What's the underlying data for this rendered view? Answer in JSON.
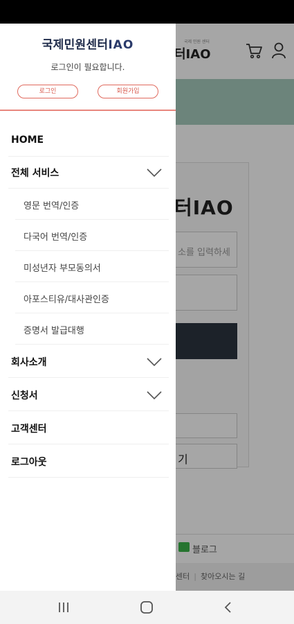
{
  "background": {
    "logo": "터IAO",
    "logo_sub": "국제 민원 센터",
    "card_logo": "터IAO",
    "id_placeholder": "소를 입력하세",
    "secondary_button": "기",
    "blog_label": "블로그",
    "footer_link_1": "센터",
    "footer_link_2": "찾아오시는 길"
  },
  "drawer": {
    "brand_korean": "국제민원센터",
    "brand_latin": "IAO",
    "login_required": "로그인이 필요합니다.",
    "login_button": "로그인",
    "signup_button": "회원가입",
    "menu": {
      "home": "HOME",
      "all_services": "전체 서비스",
      "sub_english": "영문 번역/인증",
      "sub_multilang": "다국어 번역/인증",
      "sub_minor": "미성년자 부모동의서",
      "sub_apostille": "아포스티유/대사관인증",
      "sub_certificate": "증명서 발급대행",
      "company": "회사소개",
      "application": "신청서",
      "support": "고객센터",
      "logout": "로그아웃"
    }
  },
  "colors": {
    "accent": "#e06a5e",
    "brand_navy": "#1f2b4a",
    "band": "#a6cbbd"
  },
  "icons": [
    "cart-icon",
    "user-icon",
    "chevron-down-icon",
    "recent-apps-icon",
    "home-icon",
    "back-icon",
    "blog-icon"
  ]
}
